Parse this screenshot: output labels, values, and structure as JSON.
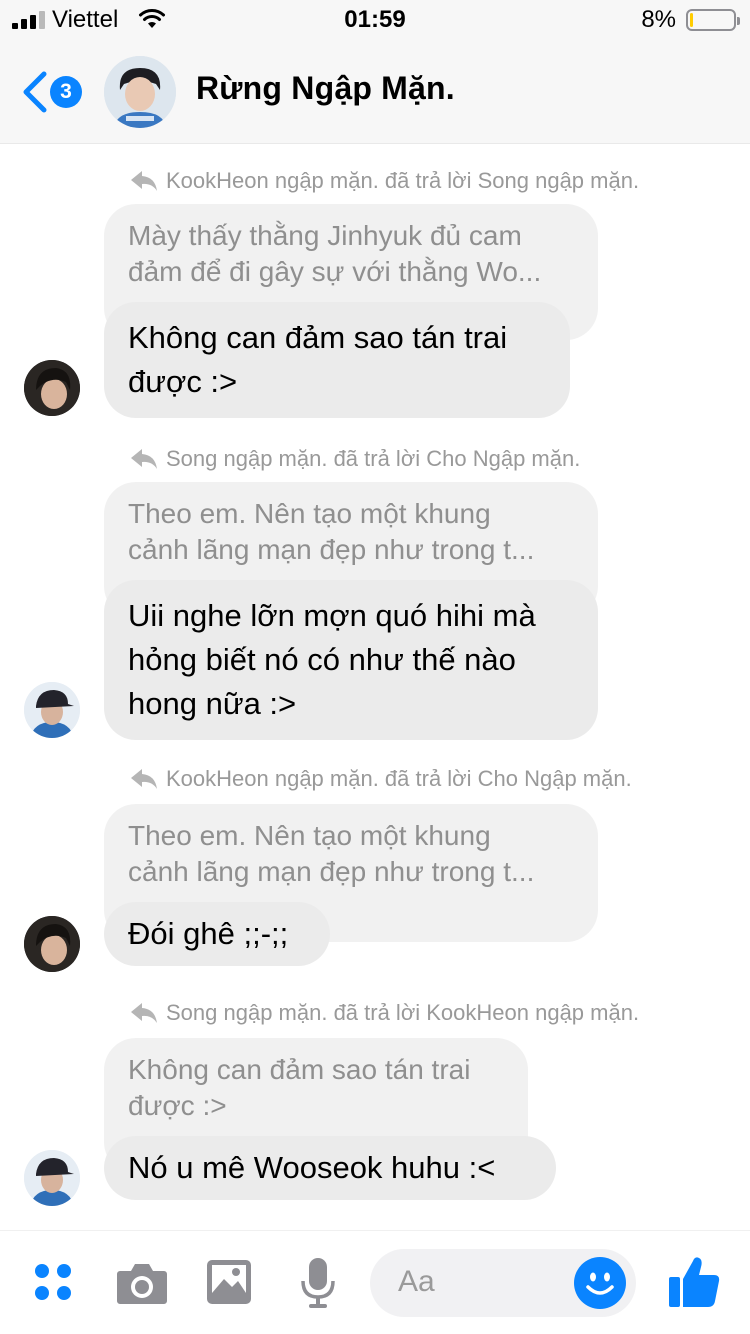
{
  "status_bar": {
    "carrier": "Viettel",
    "time": "01:59",
    "battery_percent_text": "8%",
    "battery_level": 0.08
  },
  "header": {
    "back_badge": "3",
    "title": "Rừng Ngập Mặn."
  },
  "messages": [
    {
      "reply_label": "KookHeon ngập mặn. đã trả lời Song ngập mặn.",
      "quoted_lines": [
        "Mày thấy thằng Jinhyuk đủ cam",
        "đảm để đi gây sự với thằng Wo..."
      ],
      "text_lines": [
        "Không can đảm sao tán trai",
        "được :>"
      ],
      "avatar": "dark-hair-avatar"
    },
    {
      "reply_label": "Song ngập mặn. đã trả lời Cho Ngập mặn.",
      "quoted_lines": [
        "Theo em. Nên tạo một khung",
        "cảnh lãng mạn đẹp như trong t..."
      ],
      "text_lines": [
        "Uii nghe lỡn mợn quó hihi mà",
        "hỏng biết nó có như thế nào",
        "hong nữa :>"
      ],
      "avatar": "cap-avatar"
    },
    {
      "reply_label": "KookHeon ngập mặn. đã trả lời Cho Ngập mặn.",
      "quoted_lines": [
        "Theo em. Nên tạo một khung",
        "cảnh lãng mạn đẹp như trong t..."
      ],
      "text_lines": [
        "Đói ghê ;;-;;"
      ],
      "avatar": "dark-hair-avatar"
    },
    {
      "reply_label": "Song ngập mặn. đã trả lời KookHeon ngập mặn.",
      "quoted_lines": [
        "Không can đảm sao tán trai",
        "được :>"
      ],
      "text_lines": [
        "Nó u mê Wooseok huhu :<"
      ],
      "avatar": "cap-avatar"
    }
  ],
  "composer": {
    "placeholder": "Aa",
    "icons": [
      "apps-icon",
      "camera-icon",
      "photo-icon",
      "microphone-icon",
      "emoji-icon",
      "thumbs-up-icon"
    ]
  },
  "colors": {
    "accent": "#0a84ff",
    "bubble": "#ebebeb",
    "quoted_bubble": "#f1f1f1",
    "label_gray": "#999999",
    "battery": "#ffcc00"
  }
}
